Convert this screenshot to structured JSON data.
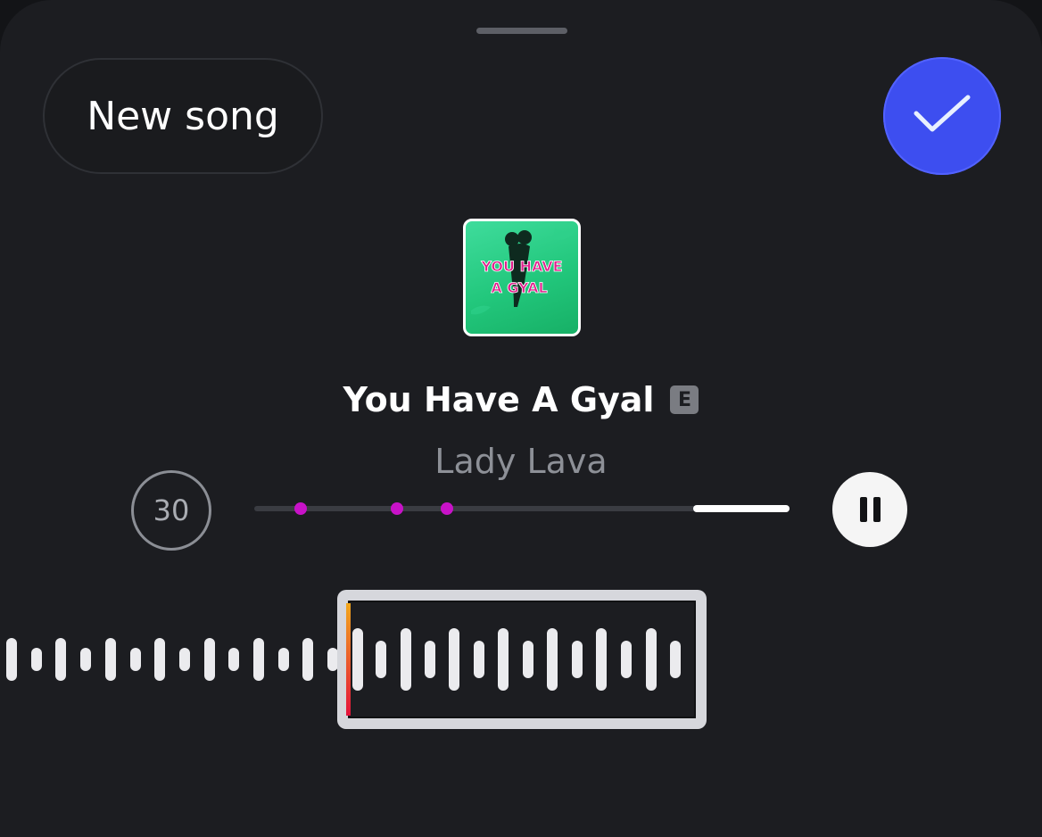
{
  "header": {
    "new_song_label": "New song",
    "done_icon": "checkmark-icon"
  },
  "song": {
    "title": "You Have A Gyal",
    "explicit_badge": "E",
    "artist": "Lady Lava"
  },
  "player": {
    "duration_label": "30",
    "progress_start": 0.82,
    "progress_end": 1.0,
    "marker_positions": [
      0.087,
      0.267,
      0.36
    ],
    "pause_icon": "pause-icon"
  },
  "artwork": {
    "line1": "YOU HAVE",
    "line2": "A GYAL"
  },
  "colors": {
    "accent": "#3d4ef0",
    "marker": "#c812c8",
    "background": "#1c1d21"
  }
}
